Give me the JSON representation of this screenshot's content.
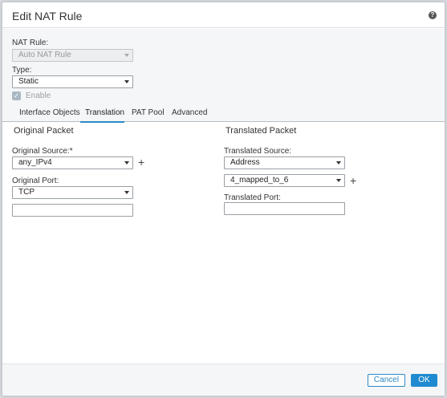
{
  "dialog": {
    "title": "Edit NAT Rule",
    "help_icon": "?"
  },
  "nat_rule": {
    "label": "NAT Rule:",
    "value": "Auto NAT Rule"
  },
  "type": {
    "label": "Type:",
    "value": "Static"
  },
  "enable": {
    "label": "Enable",
    "checked": true
  },
  "tabs": [
    {
      "label": "Interface Objects",
      "active": false
    },
    {
      "label": "Translation",
      "active": true
    },
    {
      "label": "PAT Pool",
      "active": false
    },
    {
      "label": "Advanced",
      "active": false
    }
  ],
  "original": {
    "title": "Original Packet",
    "source_label": "Original Source:*",
    "source_value": "any_IPv4",
    "port_label": "Original Port:",
    "port_protocol": "TCP",
    "port_value": ""
  },
  "translated": {
    "title": "Translated Packet",
    "source_label": "Translated Source:",
    "source_type": "Address",
    "source_value": "4_mapped_to_6",
    "port_label": "Translated Port:",
    "port_value": ""
  },
  "footer": {
    "cancel_label": "Cancel",
    "ok_label": "OK"
  },
  "colors": {
    "accent": "#1f8ad0",
    "tab_underline": "#2b8ac6"
  }
}
